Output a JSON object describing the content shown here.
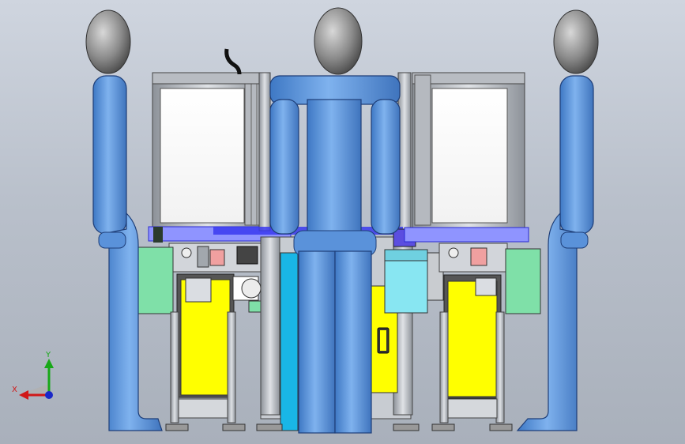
{
  "viewport": {
    "background_top": "#cfd5df",
    "background_bottom": "#a9b0bb"
  },
  "triad": {
    "x_label": "X",
    "y_label": "Y",
    "x_color": "#d01818",
    "y_color": "#18a818",
    "z_color": "#1a28c8"
  },
  "model": {
    "human_body_color": "#5a95dd",
    "human_head_color": "#7c7c7c",
    "cabinet_color": "#ffff00",
    "panel_green_color": "#7fe0a8",
    "panel_cyan_color": "#88e6f2",
    "frame_color": "#c2c6cc"
  }
}
